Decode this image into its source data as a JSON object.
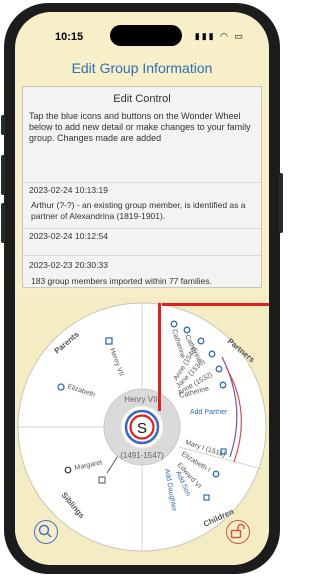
{
  "status": {
    "time": "10:15"
  },
  "header": {
    "title": "Edit Group Information"
  },
  "panel": {
    "heading": "Edit Control",
    "intro": "Tap the blue icons and buttons on the Wonder Wheel below to add new detail or make changes to your family group. Changes made are added",
    "entries": [
      {
        "date": "2023-02-24 10:13:19",
        "text": "Arthur (?-?) - an existing group member, is identified as a partner of Alexandrina (1819-1901)."
      },
      {
        "date": "2023-02-24 10:12:54",
        "text": ""
      },
      {
        "date": "2023-02-23 20:30:33",
        "text": "183 group members imported within 77 families."
      }
    ]
  },
  "wheel": {
    "center_initial": "S",
    "focus_name": "Henry VIII",
    "focus_years": "(1491-1547)",
    "sectors": {
      "parents": "Parents",
      "partners": "Partners",
      "children": "Children",
      "siblings": "Siblings"
    },
    "parents": [
      "Henry VII",
      "Elizabeth"
    ],
    "partners": [
      "Catherine",
      "Catherine",
      "Anne (1540)",
      "Jane (1536)",
      "Anne (1532)",
      "Catherine"
    ],
    "add_partner": "Add Partner",
    "children": [
      "Mary I (1516)",
      "Elizabeth I",
      "Edward VI"
    ],
    "add_daughter": "Add Daughter",
    "add_son": "Add Son",
    "siblings": [
      "Margaret"
    ]
  },
  "colors": {
    "accent": "#2f6fb5",
    "highlight": "#e02020",
    "background": "#f6efc8"
  }
}
